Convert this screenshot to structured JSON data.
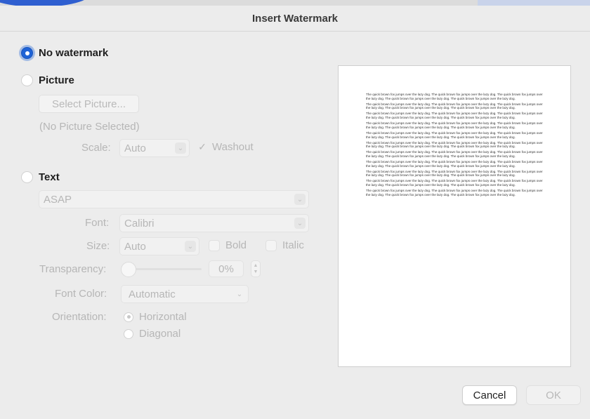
{
  "window": {
    "title": "Insert Watermark"
  },
  "options": {
    "no_watermark": "No watermark",
    "picture": "Picture",
    "text": "Text"
  },
  "picture": {
    "select_button": "Select Picture...",
    "status": "(No Picture Selected)",
    "scale_label": "Scale:",
    "scale_value": "Auto",
    "washout_label": "Washout",
    "washout_checked": true
  },
  "text_section": {
    "text_value": "ASAP",
    "font_label": "Font:",
    "font_value": "Calibri",
    "size_label": "Size:",
    "size_value": "Auto",
    "bold_label": "Bold",
    "italic_label": "Italic",
    "transparency_label": "Transparency:",
    "transparency_value": "0%",
    "transparency_fraction": 0,
    "font_color_label": "Font Color:",
    "font_color_value": "Automatic",
    "orientation_label": "Orientation:",
    "orientation_horizontal": "Horizontal",
    "orientation_diagonal": "Diagonal"
  },
  "preview": {
    "paragraph_text": "The quick brown fox jumps over the lazy dog. The quick brown fox jumps over the lazy dog. The quick brown fox jumps over the lazy dog. The quick brown fox jumps over the lazy dog. The quick brown fox jumps over the lazy dog.",
    "paragraph_count": 11
  },
  "buttons": {
    "cancel": "Cancel",
    "ok": "OK"
  },
  "colors": {
    "accent": "#1f63d6",
    "background": "#ececec"
  }
}
